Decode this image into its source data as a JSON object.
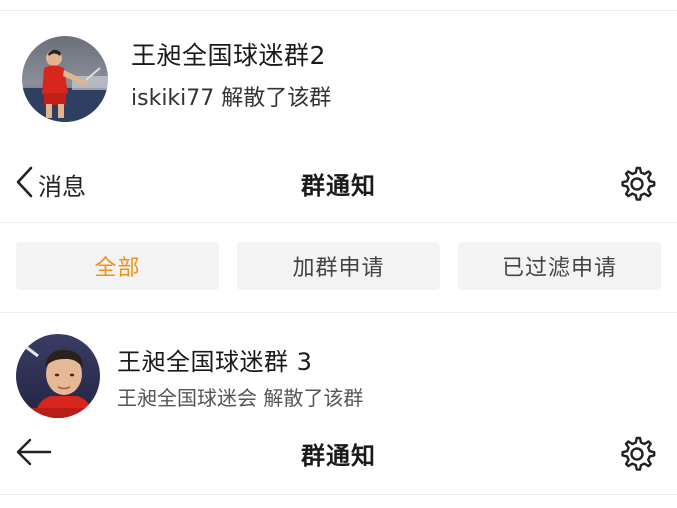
{
  "notifications": [
    {
      "title": "王昶全国球迷群2",
      "message": "iskiki77 解散了该群"
    },
    {
      "title": "王昶全国球迷群 3",
      "message": "王昶全国球迷会 解散了该群"
    }
  ],
  "navbars": [
    {
      "back_label": "消息",
      "back_icon": "chevron-left-icon",
      "title": "群通知",
      "settings_icon": "gear-icon"
    },
    {
      "back_label": "",
      "back_icon": "arrow-left-icon",
      "title": "群通知",
      "settings_icon": "gear-icon"
    }
  ],
  "tabs": [
    {
      "label": "全部",
      "selected": true
    },
    {
      "label": "加群申请",
      "selected": false
    },
    {
      "label": "已过滤申请",
      "selected": false
    }
  ],
  "colors": {
    "accent": "#f0901a",
    "tab_bg": "#f3f3f3",
    "jersey_red": "#d8261d"
  }
}
